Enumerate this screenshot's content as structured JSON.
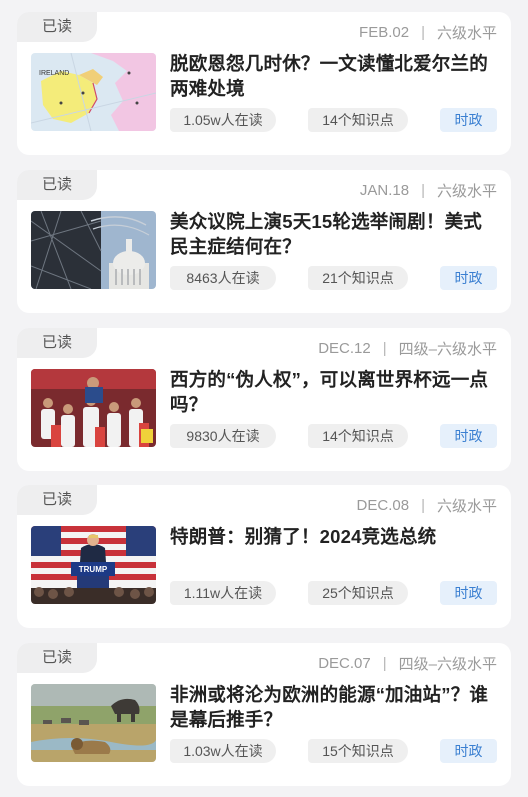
{
  "articles": [
    {
      "badge": "已读",
      "date": "FEB.02",
      "level": "六级水平",
      "title": "脱欧恩怨几时休？一文读懂北爱尔兰的两难处境",
      "readers": "1.05w人在读",
      "points": "14个知识点",
      "tag": "时政",
      "image_icon": "ireland-map-image"
    },
    {
      "badge": "已读",
      "date": "JAN.18",
      "level": "六级水平",
      "title": "美众议院上演5天15轮选举闹剧！美式民主症结何在？",
      "readers": "8463人在读",
      "points": "21个知识点",
      "tag": "时政",
      "image_icon": "capitol-building-image"
    },
    {
      "badge": "已读",
      "date": "DEC.12",
      "level": "四级–六级水平",
      "title": "西方的“伪人权”，可以离世界杯远一点吗？",
      "readers": "9830人在读",
      "points": "14个知识点",
      "tag": "时政",
      "image_icon": "football-crowd-image"
    },
    {
      "badge": "已读",
      "date": "DEC.08",
      "level": "六级水平",
      "title": "特朗普：别猜了！2024竞选总统",
      "readers": "1.11w人在读",
      "points": "25个知识点",
      "tag": "时政",
      "image_icon": "rally-podium-image",
      "podium_text": "TRUMP"
    },
    {
      "badge": "已读",
      "date": "DEC.07",
      "level": "四级–六级水平",
      "title": "非洲或将沦为欧洲的能源“加油站”？谁是幕后推手？",
      "readers": "1.03w人在读",
      "points": "15个知识点",
      "tag": "时政",
      "image_icon": "savanna-wildlife-image"
    }
  ]
}
